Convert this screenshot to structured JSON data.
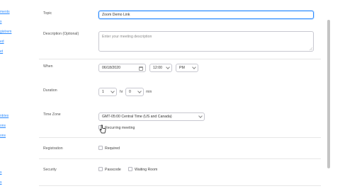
{
  "sidebar": {
    "links": [
      "ments",
      "s",
      "gistrem",
      "ed",
      "et",
      "ntries",
      "ons",
      "ons",
      "s",
      "s"
    ]
  },
  "form": {
    "topic": {
      "label": "Topic",
      "value": "Zoom Demo Link"
    },
    "description": {
      "label": "Description (Optional)",
      "placeholder": "Enter your meeting description"
    },
    "when": {
      "label": "When",
      "date": "06/18/2020",
      "time": "12:00",
      "ampm": "PM"
    },
    "duration": {
      "label": "Duration",
      "hours": "1",
      "hr_unit": "hr",
      "minutes": "0",
      "min_unit": "min"
    },
    "time_zone": {
      "label": "Time Zone",
      "value": "GMT-05:00 Central Time (US and Canada)"
    },
    "recurring": {
      "label": "Recurring meeting"
    },
    "registration": {
      "label": "Registration",
      "option": "Required"
    },
    "security": {
      "label": "Security",
      "passcode": "Passcode",
      "waiting_room": "Waiting Room"
    }
  },
  "colors": {
    "accent": "#2d8cff",
    "border": "#c8c8d0",
    "scrollbar": "#c4c4c4"
  },
  "icons": [
    "calendar-icon",
    "chevron-down-icon",
    "cursor-pointer-icon",
    "resize-grip-icon"
  ]
}
